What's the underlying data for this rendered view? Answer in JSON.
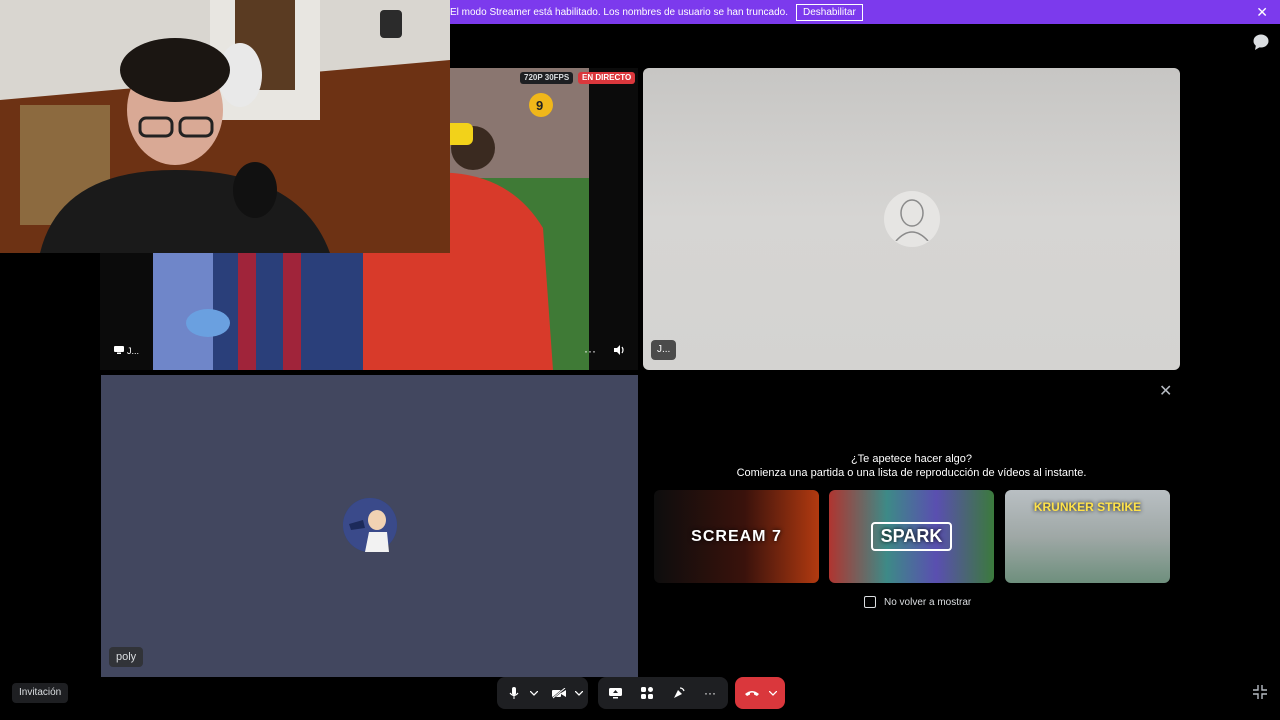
{
  "banner": {
    "text": "El modo Streamer está habilitado. Los nombres de usuario se han truncado.",
    "button": "Deshabilitar",
    "close": "✕"
  },
  "stream": {
    "quality": "720P 30FPS",
    "live": "EN DIRECTO",
    "name": "J...",
    "more": "···",
    "volume_icon": "speaker-icon"
  },
  "tile_j": {
    "name": "J..."
  },
  "tile_poly": {
    "name": "poly"
  },
  "activities": {
    "title": "¿Te apetece hacer algo?",
    "subtitle": "Comienza una partida o una lista de reproducción de vídeos al instante.",
    "games": [
      {
        "label": "SCREAM 7"
      },
      {
        "label": "SPARK"
      },
      {
        "label": "KRUNKER STRIKE"
      }
    ],
    "dont_show": "No volver a mostrar",
    "close": "✕"
  },
  "footer": {
    "invite": "Invitación",
    "more": "···"
  },
  "colors": {
    "banner": "#7c3aed",
    "hangup": "#da373c",
    "live": "#da373c",
    "poly_tile": "#42475f"
  }
}
